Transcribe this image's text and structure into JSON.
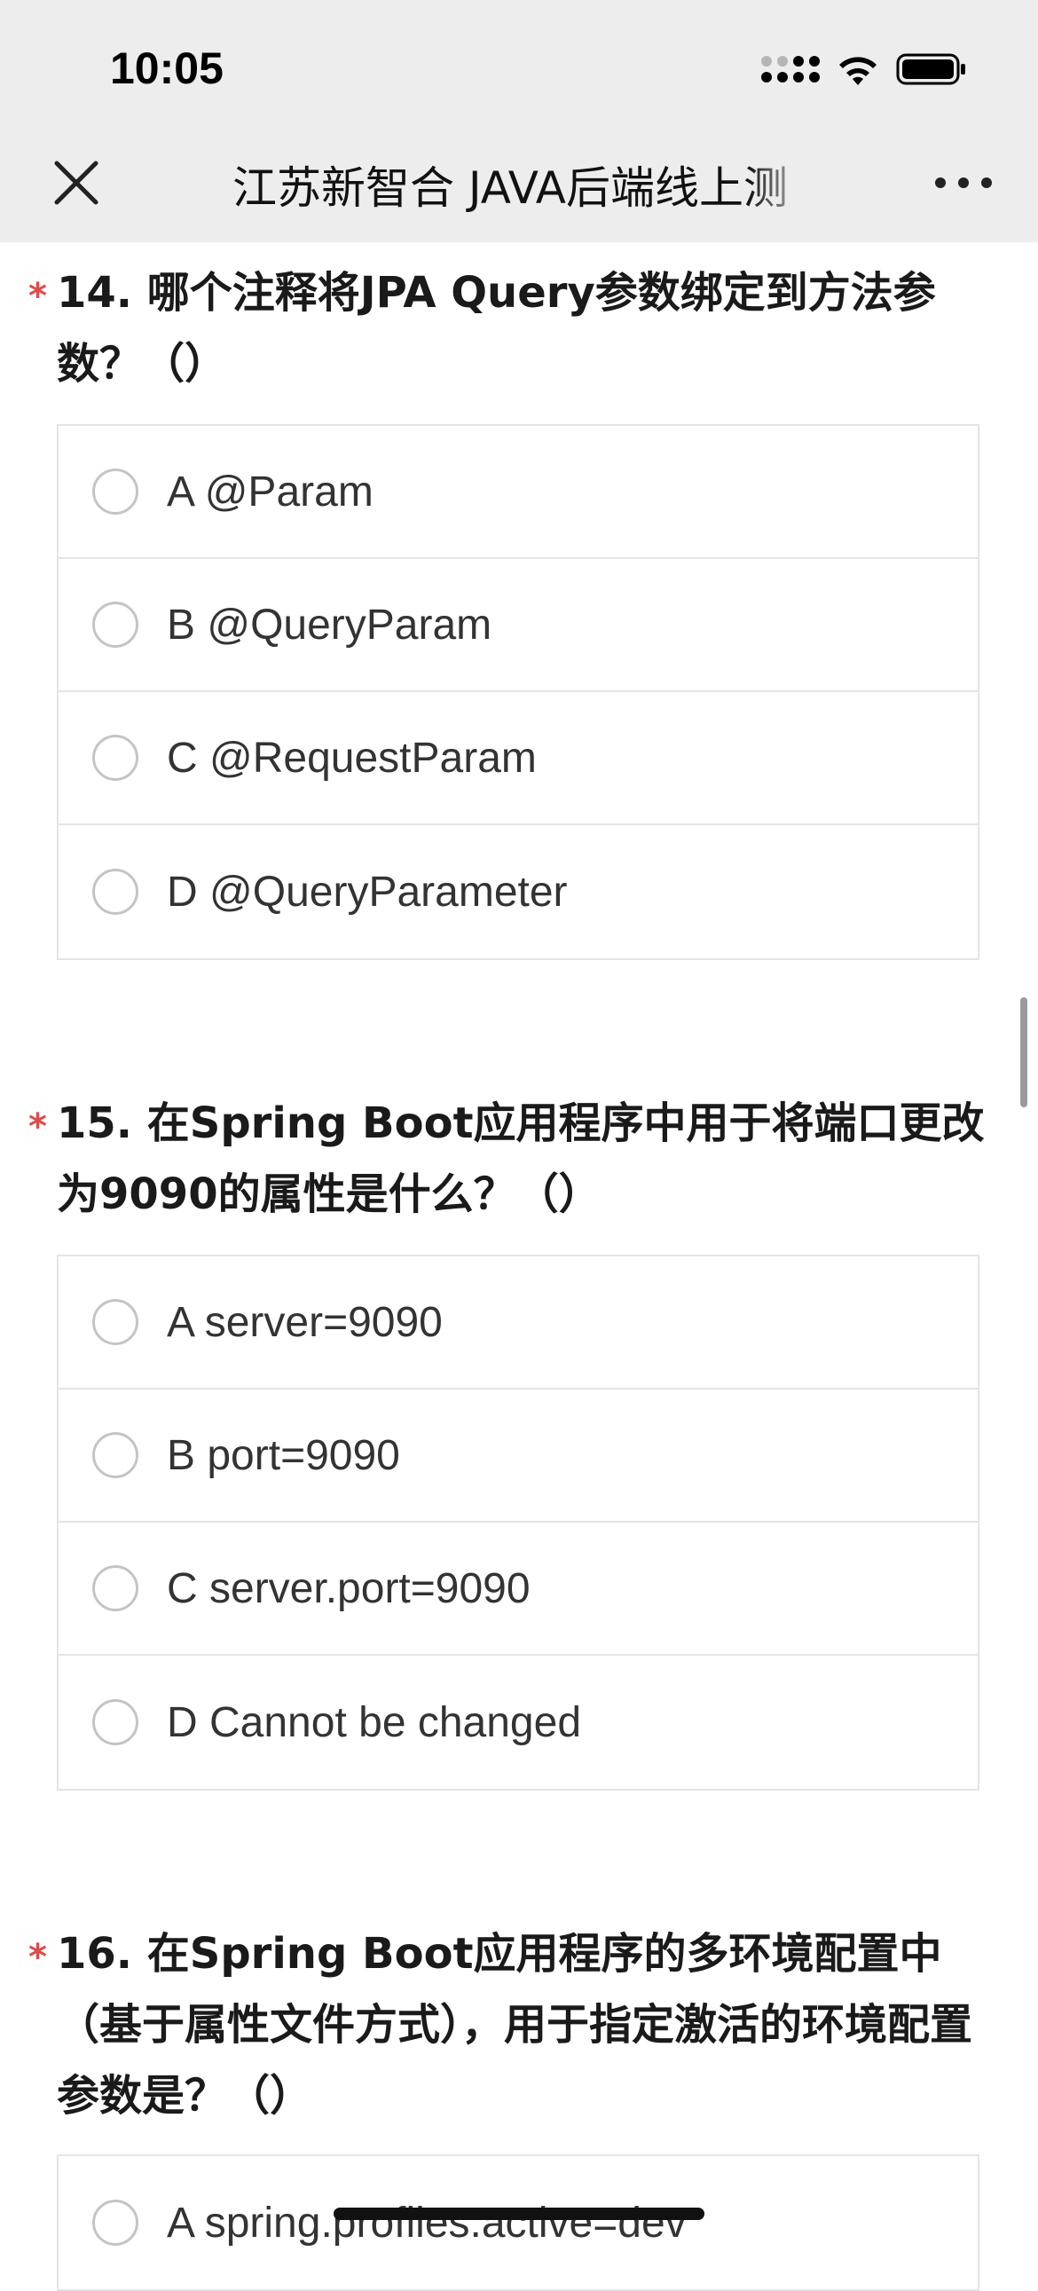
{
  "status_bar": {
    "time": "10:05"
  },
  "nav": {
    "title": "江苏新智合 JAVA后端线上测"
  },
  "questions": [
    {
      "star": "*",
      "title": "14. 哪个注释将JPA Query参数绑定到方法参数？（）",
      "options": [
        "A @Param",
        "B @QueryParam",
        "C @RequestParam",
        "D @QueryParameter"
      ]
    },
    {
      "star": "*",
      "title": "15. 在Spring Boot应用程序中用于将端口更改为9090的属性是什么？（）",
      "options": [
        "A server=9090",
        "B port=9090",
        "C server.port=9090",
        "D Cannot be changed"
      ]
    },
    {
      "star": "*",
      "title": "16. 在Spring Boot应用程序的多环境配置中（基于属性文件方式），用于指定激活的环境配置参数是？（）",
      "options": [
        "A spring.profiles.active=dev"
      ]
    }
  ]
}
